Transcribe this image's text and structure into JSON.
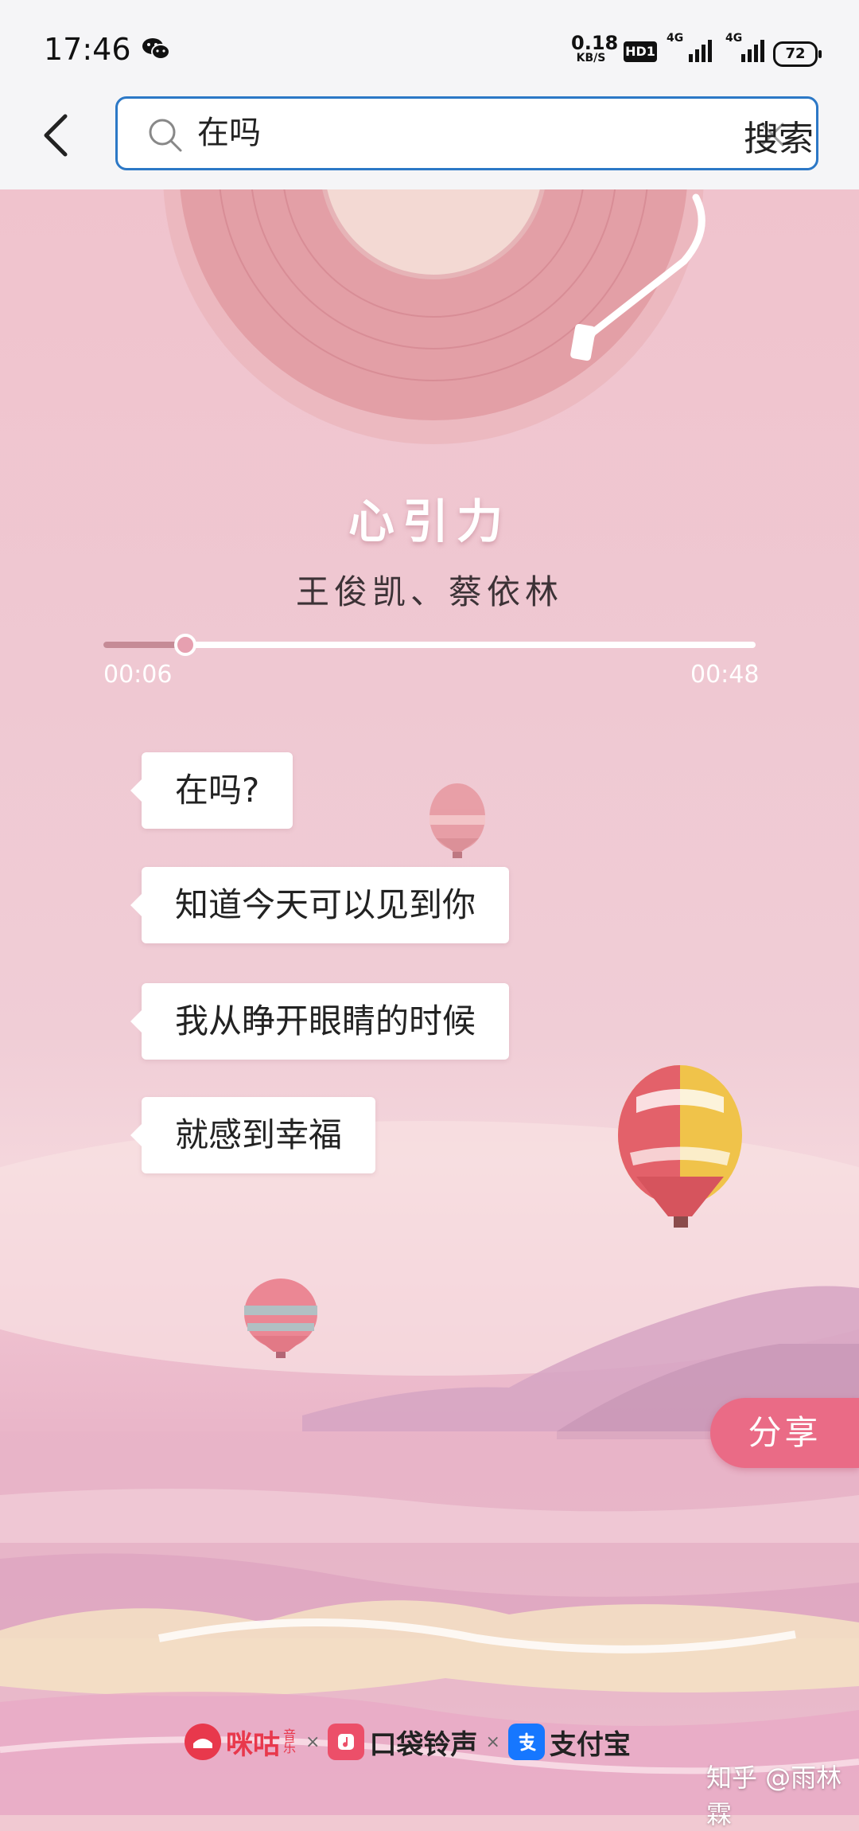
{
  "status_bar": {
    "time": "17:46",
    "net_speed_value": "0.18",
    "net_speed_unit": "KB/S",
    "hd_label": "HD1",
    "signal1_label": "4G",
    "signal2_label": "4G",
    "battery": "72"
  },
  "search": {
    "query": "在吗",
    "button_label": "搜索"
  },
  "player": {
    "song_title": "心引力",
    "artist": "王俊凯、蔡依林",
    "current_time": "00:06",
    "total_time": "00:48",
    "progress": 0.125
  },
  "lyrics": [
    "在吗?",
    "知道今天可以见到你",
    "我从睁开眼睛的时候",
    "就感到幸福"
  ],
  "share_label": "分享",
  "footer": {
    "brand1": "咪咕",
    "brand1_sub": "音乐",
    "brand2": "口袋铃声",
    "brand3": "支付宝",
    "separator": "×",
    "watermark": "知乎 @雨林霖"
  },
  "colors": {
    "accent_blue": "#2c78c6",
    "share_pink": "#ea6b86",
    "migu_red": "#e8384c",
    "alipay_blue": "#1677ff"
  }
}
